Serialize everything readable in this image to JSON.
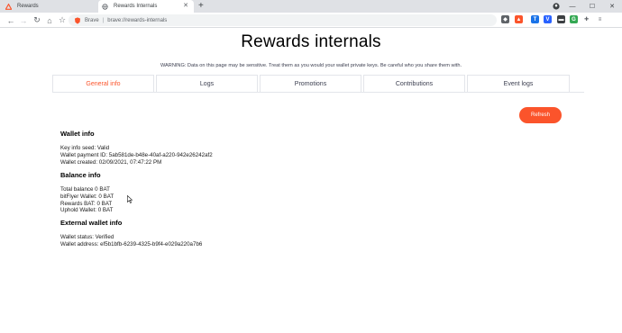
{
  "browser": {
    "tabs": [
      {
        "title": "Rewards",
        "active": false
      },
      {
        "title": "Rewards Internals",
        "active": true
      }
    ],
    "new_tab_label": "+",
    "address_bar": {
      "brand": "Brave",
      "url": "brave://rewards-internals"
    },
    "window_controls": {
      "minimize": "—",
      "maximize": "☐",
      "close": "✕"
    },
    "nav": {
      "back": "←",
      "forward": "→",
      "reload": "↻",
      "home": "⌂",
      "bookmark": "☆"
    },
    "colors": {
      "accent": "#fb542b",
      "tabstrip": "#dfe1e5"
    }
  },
  "page": {
    "title": "Rewards internals",
    "warning": "WARNING: Data on this page may be sensitive. Treat them as you would your wallet private keys. Be careful who you share them with.",
    "tabs": [
      "General info",
      "Logs",
      "Promotions",
      "Contributions",
      "Event logs"
    ],
    "active_tab": "General info",
    "refresh_label": "Refresh",
    "wallet_info": {
      "heading": "Wallet info",
      "lines": [
        "Key info seed: Valid",
        "Wallet payment ID: 5ab581de-b48e-40af-a220-942e26242af2",
        "Wallet created: 02/09/2021, 07:47:22 PM"
      ]
    },
    "balance_info": {
      "heading": "Balance info",
      "lines": [
        "Total balance 0 BAT",
        "bitFlyer Wallet: 0 BAT",
        "Rewards BAT: 0 BAT",
        "Uphold Wallet: 0 BAT"
      ]
    },
    "external_wallet_info": {
      "heading": "External wallet info",
      "lines": [
        "Wallet status: Verified",
        "Wallet address: ef5b1bfb-6239-4325-b9f4-e029a220a7b6"
      ]
    }
  }
}
